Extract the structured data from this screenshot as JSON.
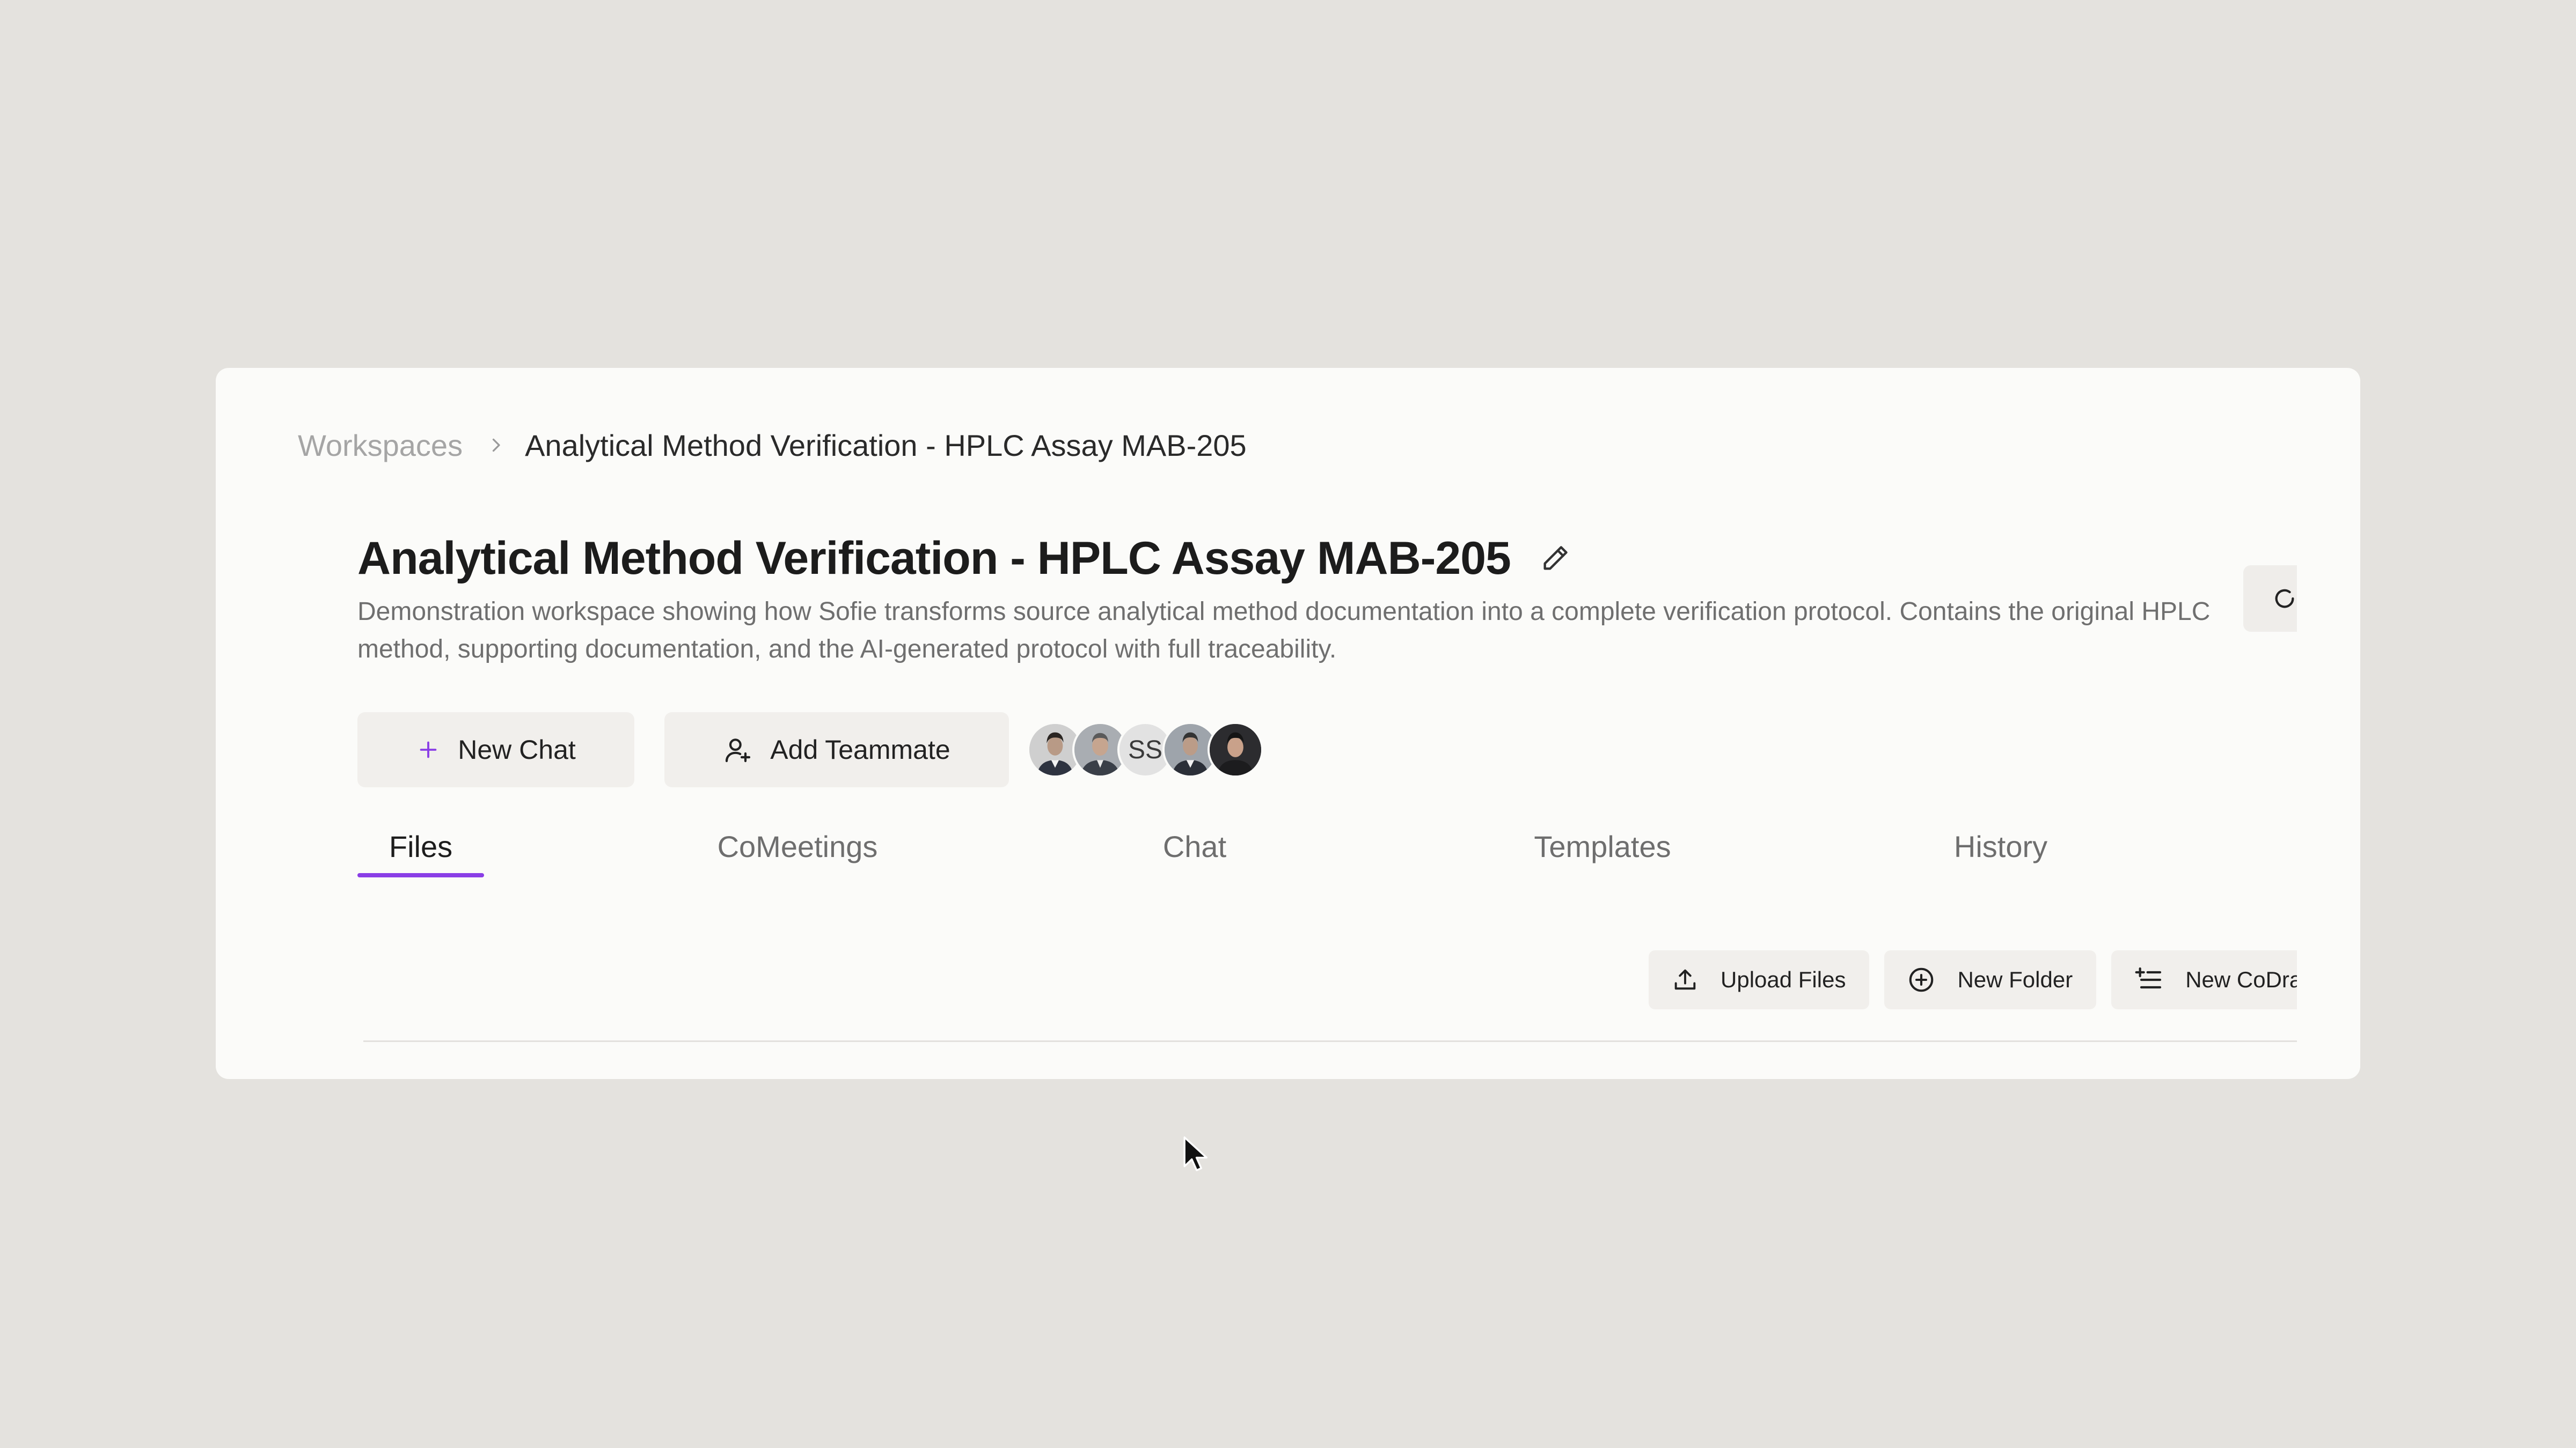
{
  "breadcrumb": {
    "root": "Workspaces",
    "current": "Analytical Method Verification - HPLC Assay MAB-205"
  },
  "workspace": {
    "title": "Analytical Method Verification - HPLC Assay MAB-205",
    "description": "Demonstration workspace showing how Sofie transforms source analytical method documentation into a complete verification protocol. Contains the original HPLC method, supporting documentation, and the AI-generated protocol with full traceability."
  },
  "actions": {
    "new_chat": "New Chat",
    "add_teammate": "Add Teammate"
  },
  "avatars": [
    {
      "type": "photo",
      "icon": "person-avatar-1"
    },
    {
      "type": "photo",
      "icon": "person-avatar-2"
    },
    {
      "type": "initials",
      "initials": "SS"
    },
    {
      "type": "photo",
      "icon": "person-avatar-3"
    },
    {
      "type": "photo",
      "icon": "person-avatar-4"
    }
  ],
  "tabs": [
    {
      "label": "Files",
      "active": true
    },
    {
      "label": "CoMeetings",
      "active": false
    },
    {
      "label": "Chat",
      "active": false
    },
    {
      "label": "Templates",
      "active": false
    },
    {
      "label": "History",
      "active": false
    }
  ],
  "toolbar": {
    "upload_files": "Upload Files",
    "new_folder": "New Folder",
    "new_codraft": "New CoDra"
  },
  "colors": {
    "background": "#e4e2de",
    "card": "#fbfbf9",
    "accent": "#8a3ee6",
    "button_bg": "#f1efec"
  }
}
